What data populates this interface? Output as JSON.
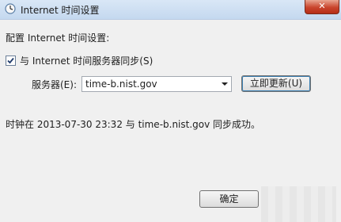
{
  "window": {
    "title": "Internet 时间设置",
    "close_label": "✕"
  },
  "intro_label": "配置 Internet 时间设置:",
  "sync_checkbox": {
    "label": "与 Internet 时间服务器同步(S)",
    "checked": true
  },
  "server": {
    "label": "服务器(E):",
    "value": "time-b.nist.gov"
  },
  "update_button": "立即更新(U)",
  "status_text": "时钟在 2013-07-30 23:32 与 time-b.nist.gov 同步成功。",
  "ok_button": "确定"
}
